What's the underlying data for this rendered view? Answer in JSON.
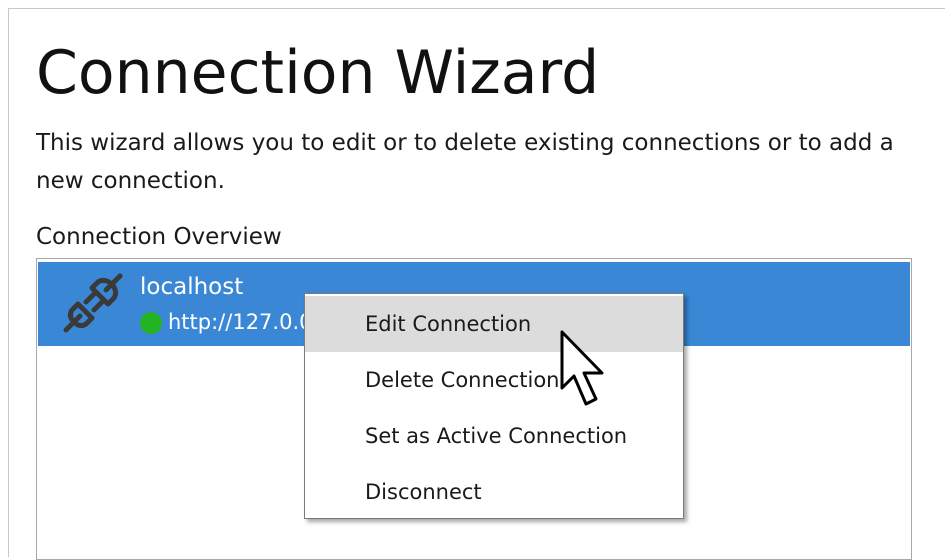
{
  "dialog": {
    "title": "Connection Wizard",
    "description": "This wizard allows you to edit or to delete existing connections or to add a new connection.",
    "overview_label": "Connection Overview"
  },
  "connections": [
    {
      "name": "localhost",
      "url": "http://127.0.0.1",
      "status_color": "#22b422",
      "icon": "plug-icon",
      "selected": true
    }
  ],
  "context_menu": {
    "items": [
      {
        "label": "Edit Connection",
        "highlighted": true
      },
      {
        "label": "Delete Connection",
        "highlighted": false
      },
      {
        "label": "Set as Active Connection",
        "highlighted": false
      },
      {
        "label": "Disconnect",
        "highlighted": false
      }
    ]
  },
  "colors": {
    "selection": "#3a87d6",
    "menu_highlight": "#dcdcdc",
    "status_connected": "#22b422"
  },
  "cursor_icon": "arrow-pointer-icon"
}
